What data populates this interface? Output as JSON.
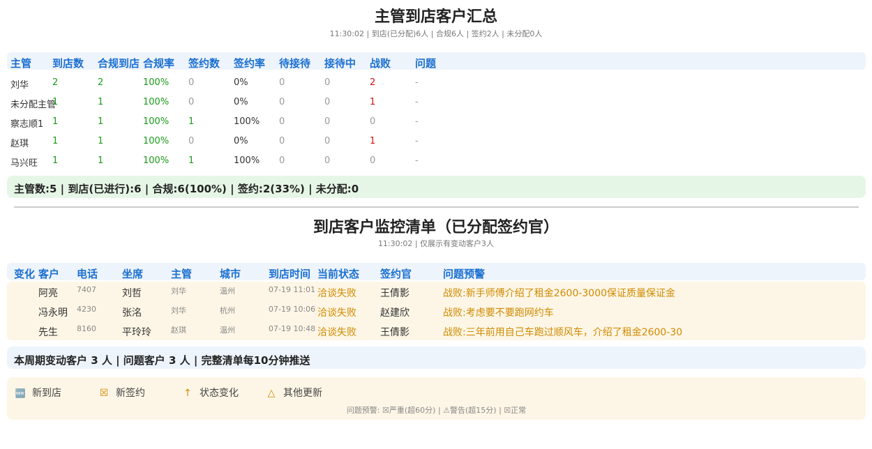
{
  "section1": {
    "title": "主管到店客户汇总",
    "subtitle": "11:30:02 | 到店(已分配)6人 | 合规6人 | 签约2人 | 未分配0人",
    "headers": [
      "主管",
      "到店数",
      "合规到店",
      "合规率",
      "签约数",
      "签约率",
      "待接待",
      "接待中",
      "战败",
      "问题"
    ],
    "rows": [
      [
        "刘华",
        "2",
        "2",
        "100%",
        "0",
        "0%",
        "0",
        "0",
        "2",
        "-"
      ],
      [
        "未分配主管",
        "1",
        "1",
        "100%",
        "0",
        "0%",
        "0",
        "0",
        "1",
        "-"
      ],
      [
        "察志顺1",
        "1",
        "1",
        "100%",
        "1",
        "100%",
        "0",
        "0",
        "0",
        "-"
      ],
      [
        "赵琪",
        "1",
        "1",
        "100%",
        "0",
        "0%",
        "0",
        "0",
        "1",
        "-"
      ],
      [
        "马兴旺",
        "1",
        "1",
        "100%",
        "1",
        "100%",
        "0",
        "0",
        "0",
        "-"
      ]
    ],
    "summary": "主管数:5 | 到店(已进行):6 | 合规:6(100%) | 签约:2(33%) | 未分配:0"
  },
  "section2": {
    "title": "到店客户监控清单（已分配签约官）",
    "subtitle": "11:30:02 | 仅展示有变动客户3人",
    "headers": [
      "变化",
      "客户",
      "电话",
      "坐席",
      "主管",
      "城市",
      "到店时间",
      "当前状态",
      "签约官",
      "问题预警"
    ],
    "rows": [
      [
        "",
        "阿亮",
        "7407",
        "刘哲",
        "刘华",
        "温州",
        "07-19 11:01",
        "洽谈失败",
        "王倩影",
        "战败:新手师傅介绍了租金2600-3000保证质量保证金"
      ],
      [
        "",
        "冯永明",
        "4230",
        "张洺",
        "刘华",
        "杭州",
        "07-19 10:06",
        "洽谈失败",
        "赵建欣",
        "战败:考虑要不要跑网约车"
      ],
      [
        "",
        "先生",
        "8160",
        "平玲玲",
        "赵琪",
        "温州",
        "07-19 10:48",
        "洽谈失败",
        "王倩影",
        "战败:三年前用自己车跑过顺风车，介绍了租金2600-30"
      ]
    ],
    "summary": "本周期变动客户 3 人 | 问题客户 3 人 | 完整清单每10分钟推送"
  },
  "legend": {
    "items": [
      {
        "icon": "new-icon",
        "glyph": "🆕",
        "label": "新到店"
      },
      {
        "icon": "cross-box-icon",
        "glyph": "☒",
        "label": "新签约"
      },
      {
        "icon": "arrow-up-icon",
        "glyph": "↑",
        "label": "状态变化"
      },
      {
        "icon": "triangle-icon",
        "glyph": "△",
        "label": "其他更新"
      }
    ],
    "note": "问题预警: ☒严重(超60分) | ⚠警告(超15分) | ☒正常"
  },
  "colors": {
    "header_blue": "#1a6fd0",
    "green": "#1a9a1a",
    "red": "#d01010",
    "orange": "#d08a00"
  }
}
